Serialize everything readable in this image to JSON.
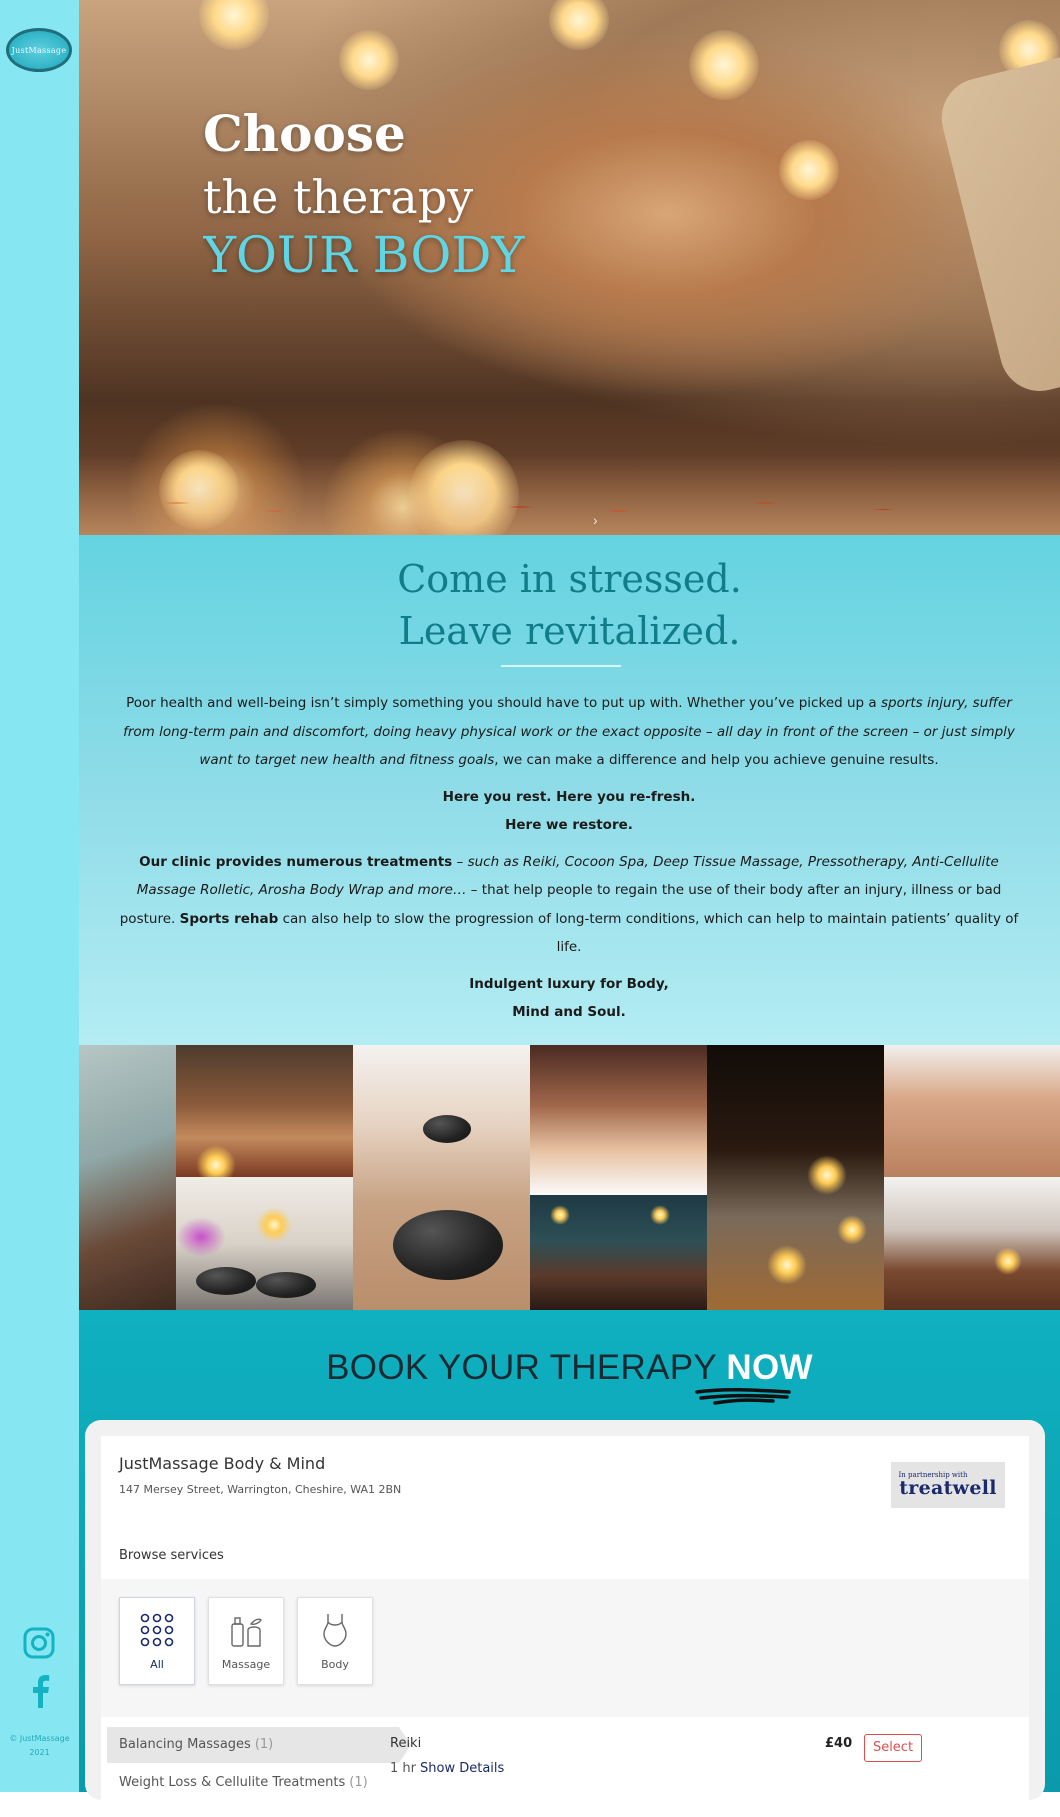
{
  "sidebar": {
    "logo_text": "JustMassage",
    "copyright_line1": "© JustMassage",
    "copyright_line2": "2021"
  },
  "hero": {
    "line1": "Choose",
    "line2": "the therapy",
    "line3": "YOUR BODY"
  },
  "intro": {
    "title_line1": "Come in stressed.",
    "title_line2": "Leave revitalized.",
    "p1_a": "Poor health and well-being isn’t simply something you should have to put up with. Whether you’ve picked up a ",
    "p1_em": "sports injury, suffer from long-term pain and discomfort, doing heavy physical work or the exact opposite – all day in front of the screen – or just simply want to target new health and fitness goals",
    "p1_b": ", we can make a difference and help you achieve genuine results.",
    "p2_line1": "Here you rest. Here you re-fresh.",
    "p2_line2": "Here we restore.",
    "p3_bold": "Our clinic provides numerous treatments",
    "p3_a": " – ",
    "p3_em": "such as Reiki, Cocoon Spa, Deep Tissue Massage, Pressotherapy, Anti-Cellulite Massage Rolletic, Arosha Body Wrap and more…",
    "p3_b": " – that help people to regain the use of their body after an injury, illness or bad posture. ",
    "p3_bold2": "Sports rehab",
    "p3_c": " can also help to slow the progression of long-term conditions, which can help to maintain patients’ quality of life.",
    "p4_line1": "Indulgent luxury for Body,",
    "p4_line2": "Mind and Soul."
  },
  "booking": {
    "title_a": "BOOK YOUR THERAPY ",
    "title_b": "NOW",
    "business_name": "JustMassage Body & Mind",
    "address": "147 Mersey Street, Warrington, Cheshire, WA1 2BN",
    "partner_small": "In partnership with",
    "partner_big": "treatwell",
    "browse_label": "Browse services",
    "categories": [
      {
        "label": "All",
        "icon": "grid-icon"
      },
      {
        "label": "Massage",
        "icon": "massage-bottles-icon"
      },
      {
        "label": "Body",
        "icon": "body-icon"
      }
    ],
    "service_groups": [
      {
        "name": "Balancing Massages",
        "count": "(1)"
      },
      {
        "name": "Weight Loss & Cellulite Treatments",
        "count": "(1)"
      }
    ],
    "service": {
      "name": "Reiki",
      "duration": "1 hr",
      "details_label": "Show Details",
      "price": "£40",
      "select_label": "Select"
    }
  },
  "colors": {
    "sidebar": "#86e6f2",
    "accent_teal": "#117d89",
    "booking_bg": "#0fb0c0",
    "treatwell_navy": "#1a2a6a",
    "select_red": "#e04c4c"
  }
}
